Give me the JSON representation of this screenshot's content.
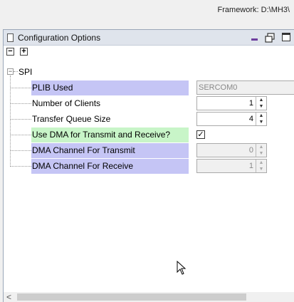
{
  "framework": {
    "label": "Framework: D:\\MH3\\"
  },
  "panel": {
    "title": "Configuration Options",
    "toolbar": {
      "collapse_all": "−",
      "expand_all": "+"
    }
  },
  "tree": {
    "node_toggle": "−",
    "root_label": "SPI",
    "rows": [
      {
        "label": "PLIB Used",
        "value": "SERCOM0"
      },
      {
        "label": "Number of Clients",
        "value": "1"
      },
      {
        "label": "Transfer Queue Size",
        "value": "4"
      },
      {
        "label": "Use DMA for Transmit and Receive?",
        "value": "✓"
      },
      {
        "label": "DMA Channel For Transmit",
        "value": "0"
      },
      {
        "label": "DMA Channel For Receive",
        "value": "1"
      }
    ]
  },
  "spinner": {
    "up": "▲",
    "down": "▼"
  },
  "scrollbar": {
    "left_arrow": "<"
  },
  "colors": {
    "blue_row": "#c5c5f5",
    "green_row": "#c8f5c8",
    "titlebar": "#dfe4ec"
  }
}
